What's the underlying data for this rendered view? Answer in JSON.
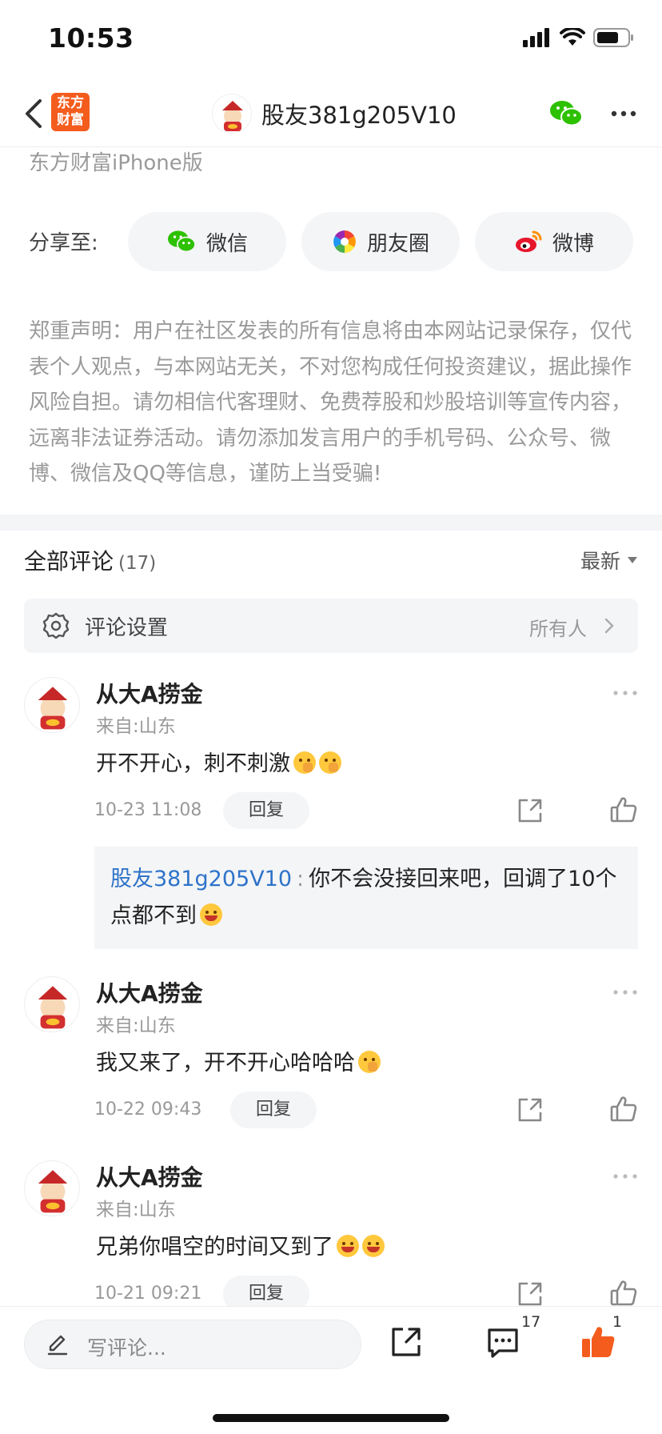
{
  "status_bar": {
    "time": "10:53"
  },
  "nav": {
    "logo_text": "东方\n财富",
    "title": "股友381g205V10"
  },
  "source": "东方财富iPhone版",
  "share": {
    "label": "分享至:",
    "buttons": [
      {
        "label": "微信",
        "icon": "wechat-icon"
      },
      {
        "label": "朋友圈",
        "icon": "moments-icon"
      },
      {
        "label": "微博",
        "icon": "weibo-icon"
      }
    ]
  },
  "disclaimer": "郑重声明：用户在社区发表的所有信息将由本网站记录保存，仅代表个人观点，与本网站无关，不对您构成任何投资建议，据此操作风险自担。请勿相信代客理财、免费荐股和炒股培训等宣传内容，远离非法证券活动。请勿添加发言用户的手机号码、公众号、微博、微信及QQ等信息，谨防上当受骗!",
  "comments_header": {
    "title": "全部评论",
    "count": "(17)",
    "sort": "最新"
  },
  "comment_settings": {
    "label": "评论设置",
    "value": "所有人"
  },
  "comments": [
    {
      "name": "从大A捞金",
      "location": "来自:山东",
      "text": "开不开心，刺不刺激",
      "emojis": [
        "hand-over-mouth",
        "hand-over-mouth"
      ],
      "time": "10-23 11:08",
      "reply_label": "回复",
      "quote": {
        "user": "股友381g205V10",
        "colon": ":",
        "text": "你不会没接回来吧，回调了10个点都不到",
        "emoji": "grinning-squint"
      }
    },
    {
      "name": "从大A捞金",
      "location": "来自:山东",
      "text": "我又来了，开不开心哈哈哈",
      "emojis": [
        "hand-over-mouth"
      ],
      "time": "10-22 09:43",
      "reply_label": "回复"
    },
    {
      "name": "从大A捞金",
      "location": "来自:山东",
      "text": "兄弟你唱空的时间又到了",
      "emojis": [
        "grinning-squint",
        "grinning-squint"
      ],
      "time": "10-21 09:21",
      "reply_label": "回复"
    }
  ],
  "bottom_bar": {
    "input_placeholder": "写评论...",
    "comment_count": "17",
    "like_count": "1"
  },
  "colors": {
    "brand": "#f45c1d",
    "link": "#2e73c9",
    "wechat": "#2dc100",
    "like": "#f45c1d"
  }
}
